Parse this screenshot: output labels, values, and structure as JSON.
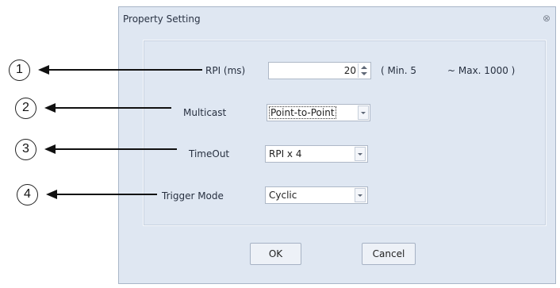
{
  "dialog": {
    "title": "Property Setting",
    "close_glyph": "⊗"
  },
  "rpi": {
    "label": "RPI (ms)",
    "value": "20",
    "min_text": "( Min. 5",
    "max_text": "~ Max. 1000  )"
  },
  "multicast": {
    "label": "Multicast",
    "selected": "Point-to-Point"
  },
  "timeout": {
    "label": "TimeOut",
    "selected": "RPI x 4"
  },
  "trigger": {
    "label": "Trigger Mode",
    "selected": "Cyclic"
  },
  "buttons": {
    "ok": "OK",
    "cancel": "Cancel"
  },
  "callouts": [
    "1",
    "2",
    "3",
    "4"
  ]
}
